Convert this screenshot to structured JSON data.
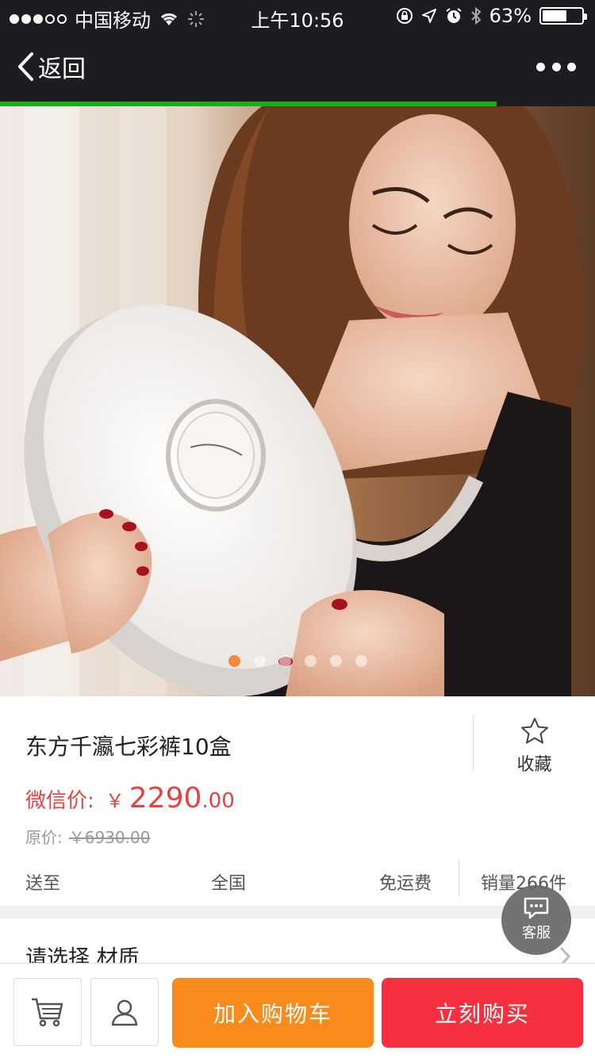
{
  "status_bar": {
    "carrier": "中国移动",
    "time": "上午10:56",
    "battery_percent": "63%",
    "battery_level": 0.63,
    "icons": [
      "signal-dots",
      "wifi-icon",
      "loading-spinner-icon",
      "orientation-lock-icon",
      "location-arrow-icon",
      "alarm-clock-icon",
      "bluetooth-icon",
      "battery-icon"
    ]
  },
  "nav": {
    "back_label": "返回",
    "more_icon": "more-dots-icon",
    "load_progress": 0.835
  },
  "carousel": {
    "image": "product-photo",
    "slide_count": 6,
    "active_index": 0
  },
  "product": {
    "title": "东方千瀛七彩裤10盒",
    "favorite_label": "收藏",
    "price_label": "微信价:",
    "currency": "￥",
    "price_int": "2290",
    "price_dec": ".00",
    "original_label": "原价:",
    "original_price": "￥6930.00",
    "ship_to": "送至",
    "region": "全国",
    "shipping": "免运费",
    "sales": "销量266件"
  },
  "options": {
    "label": "请选择 材质"
  },
  "float_service": {
    "label": "客服",
    "icon": "chat-bubble-icon"
  },
  "bottom_bar": {
    "cart_icon": "shopping-cart-icon",
    "user_icon": "user-icon",
    "add_cart_label": "加入购物车",
    "buy_now_label": "立刻购买"
  },
  "colors": {
    "price": "#e64340",
    "add_cart": "#f88b1c",
    "buy_now": "#f6303e",
    "progress": "#1aad19",
    "active_indicator": "#f08a3c"
  }
}
